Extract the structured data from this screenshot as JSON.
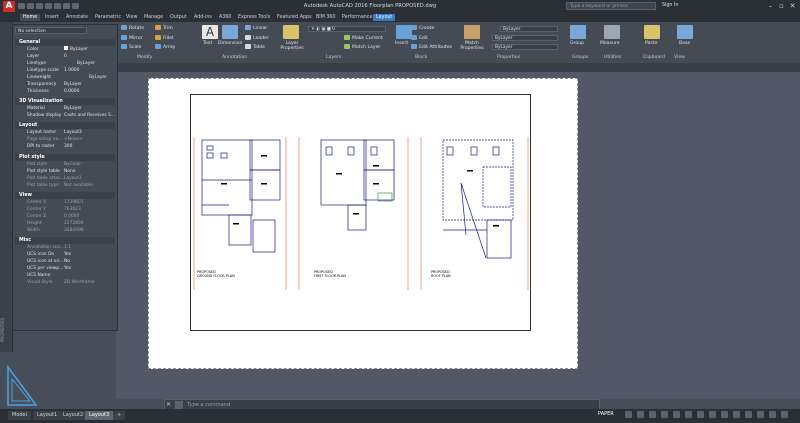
{
  "app": {
    "logo": "A",
    "title": "Autodesk AutoCAD 2016    Floorplan PROPOSED.dwg"
  },
  "search": {
    "placeholder": "Type a keyword or phrase"
  },
  "user": {
    "signin": "Sign In"
  },
  "tabs": [
    "Home",
    "Insert",
    "Annotate",
    "Parametric",
    "View",
    "Manage",
    "Output",
    "Add-ins",
    "A360",
    "Express Tools",
    "Featured Apps",
    "BIM 360",
    "Performance",
    "Layout"
  ],
  "ribbon": {
    "modify": {
      "rotate": "Rotate",
      "trim": "Trim",
      "mirror": "Mirror",
      "fillet": "Fillet",
      "scale": "Scale",
      "array": "Array",
      "label": "Modify"
    },
    "annotation": {
      "text": "Text",
      "dimension": "Dimension",
      "linear": "Linear",
      "leader": "Leader",
      "table": "Table",
      "label": "Annotation"
    },
    "layers": {
      "layer_props": "Layer Properties",
      "make_current": "Make Current",
      "match_layer": "Match Layer",
      "label": "Layers"
    },
    "block": {
      "insert": "Insert",
      "create": "Create",
      "edit": "Edit",
      "edit_attributes": "Edit Attributes",
      "label": "Block"
    },
    "properties": {
      "match": "Match Properties",
      "bylayer1": "ByLayer",
      "bylayer2": "ByLayer",
      "bylayer3": "ByLayer",
      "label": "Properties"
    },
    "groups": {
      "group": "Group",
      "label": "Groups"
    },
    "utilities": {
      "measure": "Measure",
      "label": "Utilities"
    },
    "clipboard": {
      "paste": "Paste",
      "label": "Clipboard"
    },
    "view": {
      "base": "Base",
      "label": "View"
    }
  },
  "palette": {
    "selection": "No selection",
    "sidebar_label": "PROPERTIES",
    "general": {
      "title": "General",
      "rows": [
        [
          "Color",
          "ByLayer"
        ],
        [
          "Layer",
          "0"
        ],
        [
          "Linetype",
          "ByLayer"
        ],
        [
          "Linetype scale",
          "1.0000"
        ],
        [
          "Lineweight",
          "ByLayer"
        ],
        [
          "Transparency",
          "ByLayer"
        ],
        [
          "Thickness",
          "0.0000"
        ]
      ]
    },
    "viz": {
      "title": "3D Visualization",
      "rows": [
        [
          "Material",
          "ByLayer"
        ],
        [
          "Shadow display",
          "Casts and Receives S..."
        ]
      ]
    },
    "layout": {
      "title": "Layout",
      "rows": [
        [
          "Layout name",
          "Layout3"
        ],
        [
          "Page setup na...",
          "<None>"
        ],
        [
          "DPI to raster",
          "300"
        ]
      ]
    },
    "plot": {
      "title": "Plot style",
      "rows": [
        [
          "Plot style",
          "ByColor"
        ],
        [
          "Plot style table",
          "None"
        ],
        [
          "Plot table attac...",
          "Layout3"
        ],
        [
          "Plot table type",
          "Not available"
        ]
      ]
    },
    "view": {
      "title": "View",
      "rows": [
        [
          "Center X",
          "1719601"
        ],
        [
          "Center Y",
          "763023"
        ],
        [
          "Center Z",
          "0.0000"
        ],
        [
          "Height",
          "2272804"
        ],
        [
          "Width",
          "3484996"
        ]
      ]
    },
    "misc": {
      "title": "Misc",
      "rows": [
        [
          "Annotation sca...",
          "1:1"
        ],
        [
          "UCS icon On",
          "Yes"
        ],
        [
          "UCS icon at ori...",
          "No"
        ],
        [
          "UCS per viewp...",
          "Yes"
        ],
        [
          "UCS Name",
          ""
        ],
        [
          "Visual Style",
          "2D Wireframe"
        ]
      ]
    }
  },
  "drawing": {
    "labels": [
      "PROPOSED\nGROUND FLOOR PLAN",
      "PROPOSED\nFIRST FLOOR PLAN",
      "PROPOSED\nROOF PLAN"
    ]
  },
  "command": {
    "placeholder": "Type a command"
  },
  "layout_tabs": [
    "Model",
    "Layout1",
    "Layout2",
    "Layout3"
  ],
  "status": {
    "paper": "PAPER"
  },
  "colors": {
    "accent": "#3a7bc8",
    "logo": "#c8302a",
    "paper": "#ffffff",
    "plan_lines": "#1a1a8a"
  }
}
